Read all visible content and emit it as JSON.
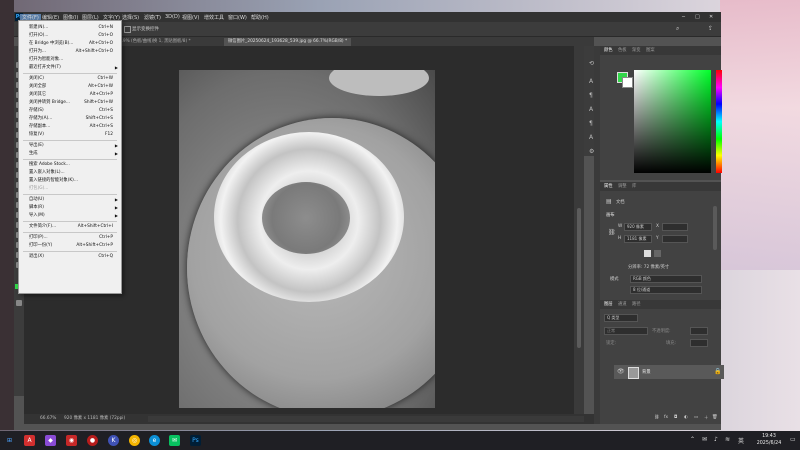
{
  "menubar": {
    "logo": "Ps",
    "items": [
      "文件(F)",
      "编辑(E)",
      "图像(I)",
      "图层(L)",
      "文字(Y)",
      "选择(S)",
      "滤镜(T)",
      "3D(D)",
      "视图(V)",
      "增效工具",
      "窗口(W)",
      "帮助(H)"
    ]
  },
  "options": {
    "transform_label": "显示变换控件"
  },
  "tabs": [
    {
      "label": "19.9% (色板/曲线)换 1, 黑贴图板/8) *"
    },
    {
      "label": "微信图片_20250624_193628_539.jpg @ 66.7%(RGB/8) *"
    }
  ],
  "file_menu": {
    "items": [
      {
        "label": "新建(N)...",
        "shortcut": "Ctrl+N"
      },
      {
        "label": "打开(O)...",
        "shortcut": "Ctrl+O"
      },
      {
        "label": "在 Bridge 中浏览(B)...",
        "shortcut": "Alt+Ctrl+O"
      },
      {
        "label": "打开为...",
        "shortcut": "Alt+Shift+Ctrl+O"
      },
      {
        "label": "打开为智能对象..."
      },
      {
        "label": "最近打开文件(T)",
        "submenu": true
      },
      {
        "sep": true
      },
      {
        "label": "关闭(C)",
        "shortcut": "Ctrl+W"
      },
      {
        "label": "关闭全部",
        "shortcut": "Alt+Ctrl+W"
      },
      {
        "label": "关闭其它",
        "shortcut": "Alt+Ctrl+P"
      },
      {
        "label": "关闭并转到 Bridge...",
        "shortcut": "Shift+Ctrl+W"
      },
      {
        "label": "存储(S)",
        "shortcut": "Ctrl+S"
      },
      {
        "label": "存储为(A)...",
        "shortcut": "Shift+Ctrl+S"
      },
      {
        "label": "存储副本...",
        "shortcut": "Alt+Ctrl+S"
      },
      {
        "label": "恢复(V)",
        "shortcut": "F12"
      },
      {
        "sep": true
      },
      {
        "label": "导出(E)",
        "submenu": true
      },
      {
        "label": "生成",
        "submenu": true
      },
      {
        "sep": true
      },
      {
        "label": "搜索 Adobe Stock..."
      },
      {
        "label": "置入嵌入对象(L)..."
      },
      {
        "label": "置入链接的智能对象(K)..."
      },
      {
        "label": "打包(G)...",
        "disabled": true
      },
      {
        "sep": true
      },
      {
        "label": "自动(U)",
        "submenu": true
      },
      {
        "label": "脚本(R)",
        "submenu": true
      },
      {
        "label": "导入(M)",
        "submenu": true
      },
      {
        "sep": true
      },
      {
        "label": "文件简介(F)...",
        "shortcut": "Alt+Shift+Ctrl+I"
      },
      {
        "sep": true
      },
      {
        "label": "打印(P)...",
        "shortcut": "Ctrl+P"
      },
      {
        "label": "打印一份(Y)",
        "shortcut": "Alt+Shift+Ctrl+P"
      },
      {
        "sep": true
      },
      {
        "label": "退出(X)",
        "shortcut": "Ctrl+Q"
      }
    ]
  },
  "color_panel": {
    "tabs": [
      "颜色",
      "色板",
      "渐变",
      "图案"
    ],
    "fg_color": "#32d64a",
    "bg_color": "#ffffff"
  },
  "properties_panel": {
    "tabs": [
      "属性",
      "调整",
      "库"
    ],
    "doc_label": "文档",
    "canvas_label": "画布",
    "width_value": "920 像素",
    "height_value": "1181 像素",
    "x_label": "X",
    "y_label": "Y",
    "resolution": "分辨率: 72 像素/英寸",
    "mode_label": "模式",
    "mode_value": "RGB 颜色",
    "depth_value": "8 位/通道"
  },
  "layers_panel": {
    "tabs": [
      "图层",
      "通道",
      "路径"
    ],
    "kind_placeholder": "Q 类型",
    "blend_mode": "正常",
    "opacity_label": "不透明度:",
    "lock_label": "锁定:",
    "fill_label": "填充:",
    "layer_name": "背景"
  },
  "status": {
    "zoom": "66.67%",
    "doc_size": "920 像素 x 1181 像素 (72ppi)"
  },
  "taskbar": {
    "lang": "英",
    "time": "19:43",
    "date": "2025/6/24"
  }
}
